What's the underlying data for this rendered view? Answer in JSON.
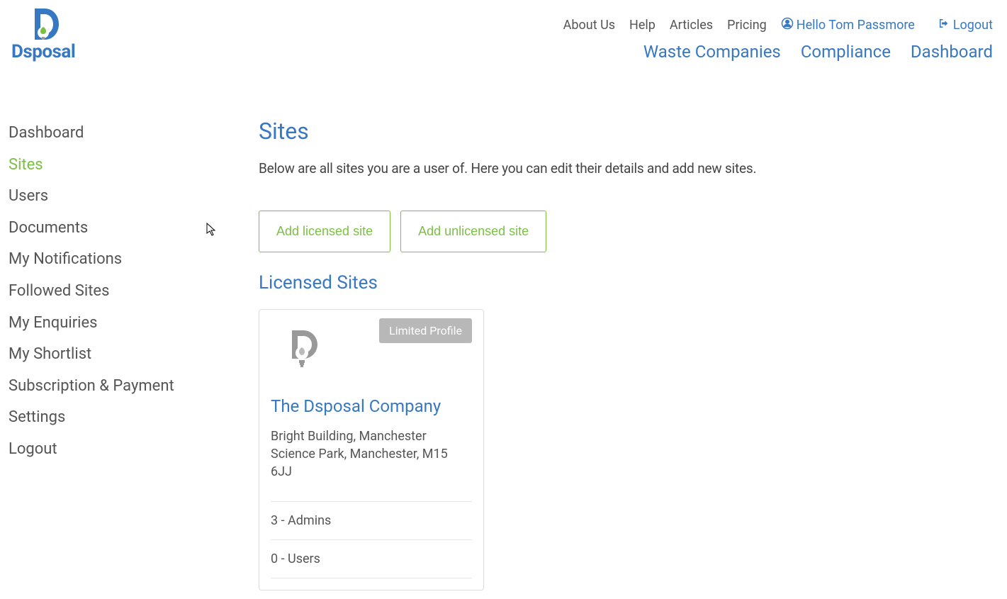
{
  "brand": {
    "name": "Dsposal"
  },
  "topNav": {
    "aboutUs": "About Us",
    "help": "Help",
    "articles": "Articles",
    "pricing": "Pricing",
    "userGreeting": "Hello Tom Passmore",
    "logout": "Logout"
  },
  "secondaryNav": {
    "wasteCompanies": "Waste Companies",
    "compliance": "Compliance",
    "dashboard": "Dashboard"
  },
  "sidebar": {
    "items": [
      {
        "label": "Dashboard",
        "active": false
      },
      {
        "label": "Sites",
        "active": true
      },
      {
        "label": "Users",
        "active": false
      },
      {
        "label": "Documents",
        "active": false
      },
      {
        "label": "My Notifications",
        "active": false
      },
      {
        "label": "Followed Sites",
        "active": false
      },
      {
        "label": "My Enquiries",
        "active": false
      },
      {
        "label": "My Shortlist",
        "active": false
      },
      {
        "label": "Subscription & Payment",
        "active": false
      },
      {
        "label": "Settings",
        "active": false
      },
      {
        "label": "Logout",
        "active": false
      }
    ]
  },
  "page": {
    "title": "Sites",
    "intro": "Below are all sites you are a user of. Here you can edit their details and add new sites.",
    "addLicensedLabel": "Add licensed site",
    "addUnlicensedLabel": "Add unlicensed site",
    "licensedSitesTitle": "Licensed Sites"
  },
  "siteCard": {
    "badge": "Limited Profile",
    "name": "The Dsposal Company",
    "address": "Bright Building, Manchester Science Park, Manchester, M15 6JJ",
    "adminsLine": "3 - Admins",
    "usersLine": "0 - Users"
  },
  "colors": {
    "primaryBlue": "#3778c2",
    "accentGreen": "#7bc043",
    "grayText": "#555",
    "badgeGray": "#b8b8b8"
  }
}
